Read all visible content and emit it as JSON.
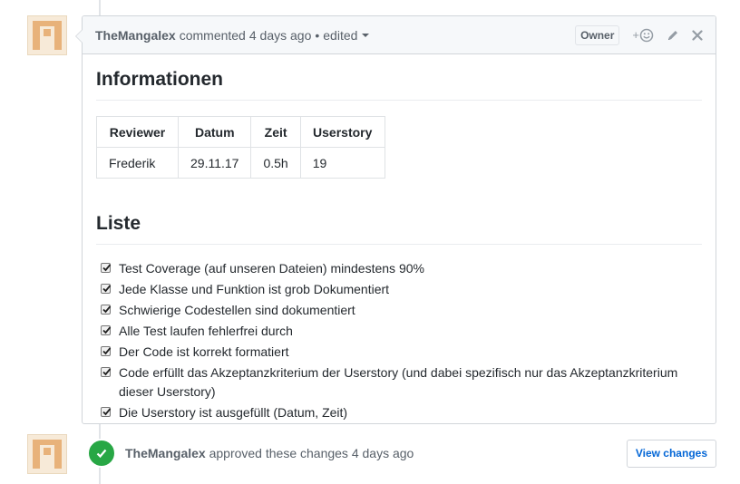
{
  "comment": {
    "author": "TheMangalex",
    "action": "commented",
    "time": "4 days ago",
    "separator": "•",
    "edited_label": "edited",
    "owner_label": "Owner",
    "react_plus": "+"
  },
  "sections": {
    "info_heading": "Informationen",
    "list_heading": "Liste"
  },
  "table": {
    "headers": [
      "Reviewer",
      "Datum",
      "Zeit",
      "Userstory"
    ],
    "rows": [
      [
        "Frederik",
        "29.11.17",
        "0.5h",
        "19"
      ]
    ]
  },
  "tasks": [
    "Test Coverage (auf unseren Dateien) mindestens 90%",
    "Jede Klasse und Funktion ist grob Dokumentiert",
    "Schwierige Codestellen sind dokumentiert",
    "Alle Test laufen fehlerfrei durch",
    "Der Code ist korrekt formatiert",
    "Code erfüllt das Akzeptanzkriterium der Userstory (und dabei spezifisch nur das Akzeptanzkriterium dieser Userstory)",
    "Die Userstory ist ausgefüllt (Datum, Zeit)"
  ],
  "review": {
    "author": "TheMangalex",
    "action": "approved these changes",
    "time": "4 days ago",
    "button_label": "View changes"
  },
  "colors": {
    "success": "#28a745",
    "link": "#0366d6",
    "avatar": "#e8b27a"
  }
}
